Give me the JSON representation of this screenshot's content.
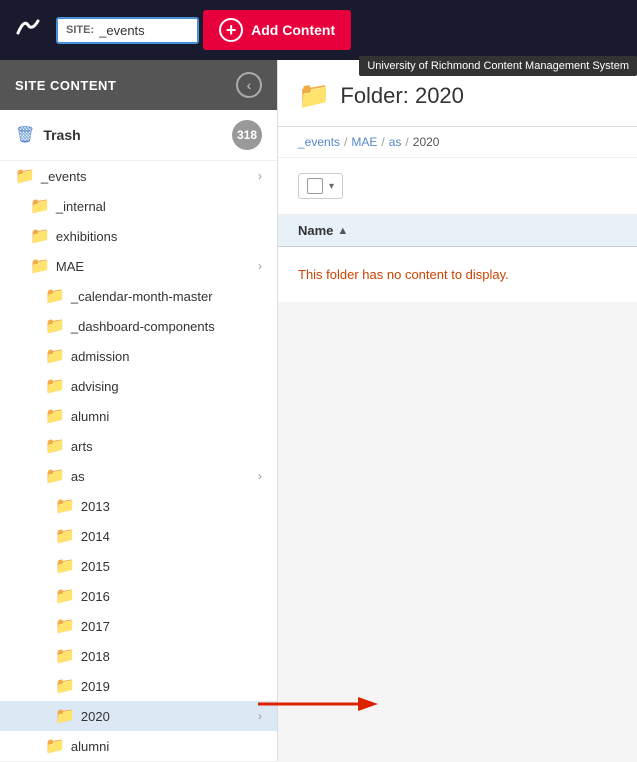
{
  "header": {
    "site_label": "SITE:",
    "site_value": "_events",
    "add_content_label": "Add Content",
    "tooltip": "University of Richmond Content Management System"
  },
  "sidebar": {
    "title": "SITE CONTENT",
    "trash": {
      "label": "Trash",
      "count": "318"
    },
    "tree": [
      {
        "id": "events",
        "label": "_events",
        "level": 1,
        "expanded": true,
        "has_arrow": true
      },
      {
        "id": "internal",
        "label": "_internal",
        "level": 2,
        "expanded": false,
        "has_arrow": false
      },
      {
        "id": "exhibitions",
        "label": "exhibitions",
        "level": 2,
        "expanded": false,
        "has_arrow": false
      },
      {
        "id": "mae",
        "label": "MAE",
        "level": 2,
        "expanded": true,
        "has_arrow": true
      },
      {
        "id": "calendar-month-master",
        "label": "_calendar-month-master",
        "level": 3,
        "expanded": false,
        "has_arrow": false
      },
      {
        "id": "dashboard-components",
        "label": "_dashboard-components",
        "level": 3,
        "expanded": false,
        "has_arrow": false
      },
      {
        "id": "admission",
        "label": "admission",
        "level": 3,
        "expanded": false,
        "has_arrow": false
      },
      {
        "id": "advising",
        "label": "advising",
        "level": 3,
        "expanded": false,
        "has_arrow": false
      },
      {
        "id": "alumni",
        "label": "alumni",
        "level": 3,
        "expanded": false,
        "has_arrow": false
      },
      {
        "id": "arts",
        "label": "arts",
        "level": 3,
        "expanded": false,
        "has_arrow": false
      },
      {
        "id": "as",
        "label": "as",
        "level": 3,
        "expanded": true,
        "has_arrow": true
      },
      {
        "id": "y2013",
        "label": "2013",
        "level": 4,
        "expanded": false,
        "has_arrow": false
      },
      {
        "id": "y2014",
        "label": "2014",
        "level": 4,
        "expanded": false,
        "has_arrow": false
      },
      {
        "id": "y2015",
        "label": "2015",
        "level": 4,
        "expanded": false,
        "has_arrow": false
      },
      {
        "id": "y2016",
        "label": "2016",
        "level": 4,
        "expanded": false,
        "has_arrow": false
      },
      {
        "id": "y2017",
        "label": "2017",
        "level": 4,
        "expanded": false,
        "has_arrow": false
      },
      {
        "id": "y2018",
        "label": "2018",
        "level": 4,
        "expanded": false,
        "has_arrow": false
      },
      {
        "id": "y2019",
        "label": "2019",
        "level": 4,
        "expanded": false,
        "has_arrow": false
      },
      {
        "id": "y2020",
        "label": "2020",
        "level": 4,
        "expanded": false,
        "has_arrow": true,
        "selected": true
      },
      {
        "id": "alumni2",
        "label": "alumni",
        "level": 3,
        "expanded": false,
        "has_arrow": false
      }
    ]
  },
  "main": {
    "folder_title": "Folder: 2020",
    "breadcrumb": [
      "_events",
      "MAE",
      "as",
      "2020"
    ],
    "name_col": "Name",
    "empty_message": "This folder has no content to display."
  }
}
